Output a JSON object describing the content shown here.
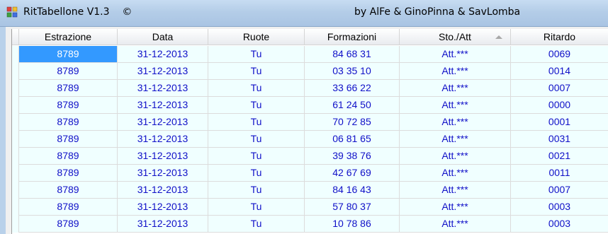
{
  "window": {
    "title": "RitTabellone V1.3",
    "copyright_symbol": "©",
    "authors": "by AlFe & GinoPinna & SavLomba"
  },
  "grid": {
    "columns": [
      "Estrazione",
      "Data",
      "Ruote",
      "Formazioni",
      "Sto./Att",
      "Ritardo"
    ],
    "sorted_column": "Sto./Att",
    "sort_direction": "ascending",
    "rows": [
      [
        "8789",
        "31-12-2013",
        "Tu",
        "84 68 31",
        "Att.***",
        "0069"
      ],
      [
        "8789",
        "31-12-2013",
        "Tu",
        "03 35 10",
        "Att.***",
        "0014"
      ],
      [
        "8789",
        "31-12-2013",
        "Tu",
        "33 66 22",
        "Att.***",
        "0007"
      ],
      [
        "8789",
        "31-12-2013",
        "Tu",
        "61 24 50",
        "Att.***",
        "0000"
      ],
      [
        "8789",
        "31-12-2013",
        "Tu",
        "70 72 85",
        "Att.***",
        "0001"
      ],
      [
        "8789",
        "31-12-2013",
        "Tu",
        "06 81 65",
        "Att.***",
        "0031"
      ],
      [
        "8789",
        "31-12-2013",
        "Tu",
        "39 38 76",
        "Att.***",
        "0021"
      ],
      [
        "8789",
        "31-12-2013",
        "Tu",
        "42 67 69",
        "Att.***",
        "0011"
      ],
      [
        "8789",
        "31-12-2013",
        "Tu",
        "84 16 43",
        "Att.***",
        "0007"
      ],
      [
        "8789",
        "31-12-2013",
        "Tu",
        "57 80 37",
        "Att.***",
        "0003"
      ],
      [
        "8789",
        "31-12-2013",
        "Tu",
        "10 78 86",
        "Att.***",
        "0003"
      ]
    ]
  },
  "colors": {
    "row_background": "#f0ffff",
    "cell_text": "#1010c8",
    "selection": "#3399ff",
    "titlebar": "#b9d1ea"
  }
}
